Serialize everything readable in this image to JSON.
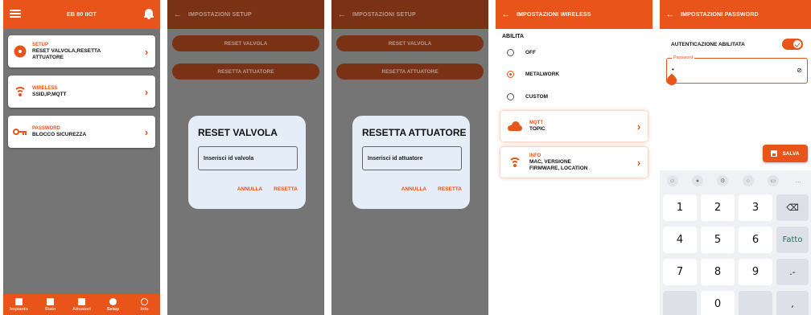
{
  "colors": {
    "accent": "#e8541a",
    "accent_dim": "#7a3214",
    "overlay": "#757575",
    "dialog_bg": "#e4edf8"
  },
  "screen1": {
    "title": "EB 80 IIOT",
    "cards": [
      {
        "icon": "gear-icon",
        "heading": "SETUP",
        "line1": "RESET VALVOLA,RESETTA",
        "line2": "ATTUATORE"
      },
      {
        "icon": "wifi-icon",
        "heading": "WIRELESS",
        "line1": "SSID,IP,MQTT",
        "line2": ""
      },
      {
        "icon": "key-icon",
        "heading": "PASSWORD",
        "line1": "BLOCCO SICUREZZA",
        "line2": ""
      }
    ],
    "nav": [
      {
        "label": "Impianto",
        "icon": "grid-icon",
        "active": false
      },
      {
        "label": "Stato",
        "icon": "list-icon",
        "active": false
      },
      {
        "label": "Attuatori",
        "icon": "list-icon",
        "active": false
      },
      {
        "label": "Setup",
        "icon": "gear-icon",
        "active": true
      },
      {
        "label": "Info",
        "icon": "info-icon",
        "active": false
      }
    ]
  },
  "screen2": {
    "title": "IMPOSTAZIONI SETUP",
    "buttons": [
      "RESET VALVOLA",
      "RESETTA ATTUATORE"
    ],
    "dialog": {
      "title": "RESET VALVOLA",
      "placeholder": "Inserisci id valvola",
      "cancel": "ANNULLA",
      "confirm": "RESETTA"
    }
  },
  "screen3": {
    "title": "IMPOSTAZIONI SETUP",
    "buttons": [
      "RESET VALVOLA",
      "RESETTA ATTUATORE"
    ],
    "dialog": {
      "title": "RESETTA ATTUATORE",
      "placeholder": "Inserisci id attuatore",
      "cancel": "ANNULLA",
      "confirm": "RESETTA"
    }
  },
  "screen4": {
    "title": "IMPOSTAZIONI WIRELESS",
    "section": "ABILITA",
    "options": [
      {
        "label": "OFF",
        "selected": false
      },
      {
        "label": "METALWORK",
        "selected": true
      },
      {
        "label": "CUSTOM",
        "selected": false
      }
    ],
    "cards": [
      {
        "icon": "cloud-icon",
        "heading": "MQTT",
        "line1": "TOPIC",
        "line2": ""
      },
      {
        "icon": "wifi-icon",
        "heading": "INFO",
        "line1": "MAC, VERSIONE",
        "line2": "FIRMWARE, LOCATION"
      }
    ]
  },
  "screen5": {
    "title": "IMPOSTAZIONI PASSWORD",
    "toggle_label": "AUTENTICAZIONE ABILITATA",
    "toggle_on": true,
    "field_label": "Password",
    "field_value": "•",
    "save_label": "SALVA",
    "keyboard": {
      "top_row": [
        "☺",
        "🎙",
        "⚙",
        "🔍",
        "📋",
        "…"
      ],
      "keys": [
        "1",
        "2",
        "3",
        "⌫",
        "4",
        "5",
        "6",
        "Fatto",
        "7",
        "8",
        "9",
        ".-",
        "",
        "0",
        "",
        ","
      ]
    }
  }
}
